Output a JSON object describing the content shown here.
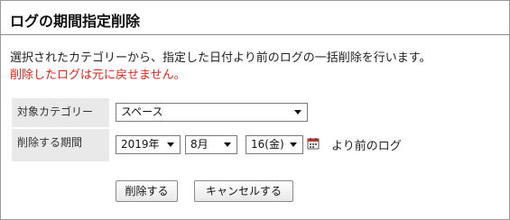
{
  "page": {
    "title": "ログの期間指定削除",
    "description": "選択されたカテゴリーから、指定した日付より前のログの一括削除を行います。",
    "warning": "削除したログは元に戻せません。",
    "warning_color": "#e3231b"
  },
  "form": {
    "category_label": "対象カテゴリー",
    "category_value": "スペース",
    "period_label": "削除する期間",
    "year_value": "2019年",
    "month_value": "8月",
    "day_value": "16(金)",
    "calendar_icon": "calendar-icon",
    "before_text": "より前のログ"
  },
  "buttons": {
    "delete_label": "削除する",
    "cancel_label": "キャンセルする"
  }
}
